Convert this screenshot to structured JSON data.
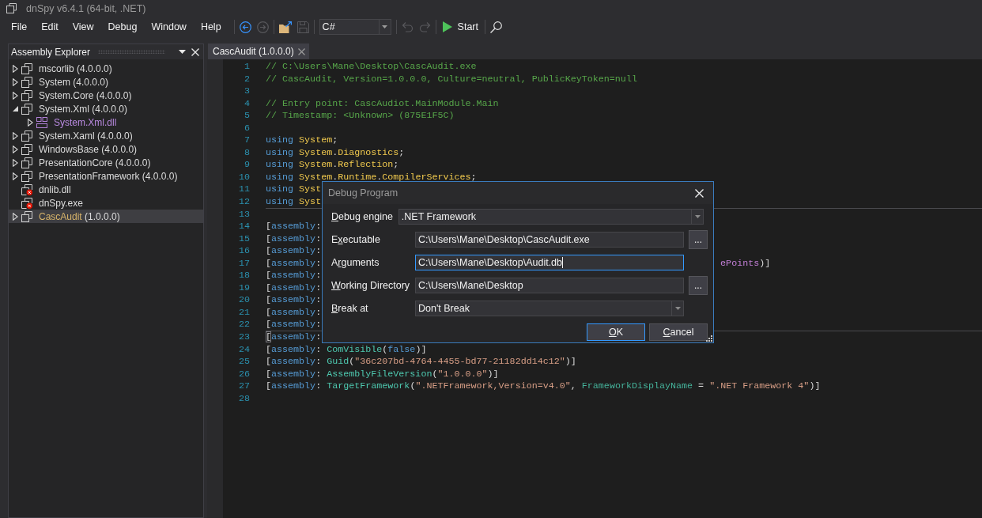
{
  "window": {
    "title": "dnSpy v6.4.1 (64-bit, .NET)"
  },
  "menu": [
    "File",
    "Edit",
    "View",
    "Debug",
    "Window",
    "Help"
  ],
  "toolbar": [
    {
      "items": [
        {
          "kind": "back",
          "disabled": false
        },
        {
          "kind": "forward",
          "disabled": true
        }
      ]
    },
    {
      "items": [
        {
          "kind": "open",
          "disabled": false
        },
        {
          "kind": "save",
          "disabled": true
        }
      ]
    },
    {
      "items": [
        {
          "kind": "language",
          "value": "C#",
          "disabled": false
        }
      ]
    },
    {
      "items": [
        {
          "kind": "undo",
          "disabled": true
        },
        {
          "kind": "redo",
          "disabled": true
        }
      ]
    },
    {
      "items": [
        {
          "kind": "start",
          "label": "Start",
          "disabled": false
        }
      ]
    },
    {
      "items": [
        {
          "kind": "search",
          "disabled": false
        }
      ]
    }
  ],
  "assembly_explorer": {
    "title": "Assembly Explorer",
    "items": [
      {
        "name": "mscorlib",
        "version": "(4.0.0.0)",
        "kind": "assembly",
        "expanded": false,
        "selected": false
      },
      {
        "name": "System",
        "version": "(4.0.0.0)",
        "kind": "assembly",
        "expanded": false,
        "selected": false
      },
      {
        "name": "System.Core",
        "version": "(4.0.0.0)",
        "kind": "assembly",
        "expanded": false,
        "selected": false
      },
      {
        "name": "System.Xml",
        "version": "(4.0.0.0)",
        "kind": "assembly",
        "expanded": true,
        "selected": false,
        "children": [
          {
            "name": "System.Xml.dll",
            "kind": "module",
            "expanded": false,
            "selected": false
          }
        ]
      },
      {
        "name": "System.Xaml",
        "version": "(4.0.0.0)",
        "kind": "assembly",
        "expanded": false,
        "selected": false
      },
      {
        "name": "WindowsBase",
        "version": "(4.0.0.0)",
        "kind": "assembly",
        "expanded": false,
        "selected": false
      },
      {
        "name": "PresentationCore",
        "version": "(4.0.0.0)",
        "kind": "assembly",
        "expanded": false,
        "selected": false
      },
      {
        "name": "PresentationFramework",
        "version": "(4.0.0.0)",
        "kind": "assembly",
        "expanded": false,
        "selected": false
      },
      {
        "name": "dnlib.dll",
        "kind": "missing",
        "selected": false
      },
      {
        "name": "dnSpy.exe",
        "kind": "missing",
        "selected": false
      },
      {
        "name": "CascAudit",
        "version": "(1.0.0.0)",
        "kind": "assembly",
        "expanded": false,
        "selected": true
      }
    ]
  },
  "editor": {
    "tabs": [
      {
        "label": "CascAudit (1.0.0.0)",
        "selected": true
      }
    ],
    "sections": [
      {
        "lines": [
          {
            "number": "1",
            "tokens": [
              {
                "kind": "comment",
                "text": "// C:\\Users\\Mane\\Desktop\\CascAudit.exe"
              }
            ]
          },
          {
            "number": "2",
            "tokens": [
              {
                "kind": "comment",
                "text": "// CascAudit, Version=1.0.0.0, Culture=neutral, PublicKeyToken=null"
              }
            ]
          },
          {
            "number": "3"
          },
          {
            "number": "4",
            "tokens": [
              {
                "kind": "comment",
                "text": "// Entry point: CascAudiot.MainModule.Main"
              }
            ]
          },
          {
            "number": "5",
            "tokens": [
              {
                "kind": "comment",
                "text": "// Timestamp: <Unknown> (875E1F5C)"
              }
            ]
          },
          {
            "number": "6"
          },
          {
            "number": "7",
            "tokens": [
              {
                "kind": "keyword",
                "text": "using "
              },
              {
                "kind": "namespace",
                "text": "System"
              },
              {
                "kind": "punct",
                "text": ";"
              }
            ]
          },
          {
            "number": "8",
            "tokens": [
              {
                "kind": "keyword",
                "text": "using "
              },
              {
                "kind": "namespace",
                "text": "System"
              },
              {
                "kind": "punct",
                "text": "."
              },
              {
                "kind": "namespace",
                "text": "Diagnostics"
              },
              {
                "kind": "punct",
                "text": ";"
              }
            ]
          },
          {
            "number": "9",
            "tokens": [
              {
                "kind": "keyword",
                "text": "using "
              },
              {
                "kind": "namespace",
                "text": "System"
              },
              {
                "kind": "punct",
                "text": "."
              },
              {
                "kind": "namespace",
                "text": "Reflection"
              },
              {
                "kind": "punct",
                "text": ";"
              }
            ]
          },
          {
            "number": "10",
            "tokens": [
              {
                "kind": "keyword",
                "text": "using "
              },
              {
                "kind": "namespace",
                "text": "System"
              },
              {
                "kind": "punct",
                "text": "."
              },
              {
                "kind": "namespace",
                "text": "Runtime"
              },
              {
                "kind": "punct",
                "text": "."
              },
              {
                "kind": "namespace",
                "text": "CompilerServices"
              },
              {
                "kind": "punct",
                "text": ";"
              }
            ]
          },
          {
            "number": "11",
            "tokens": [
              {
                "kind": "keyword",
                "text": "using "
              },
              {
                "kind": "namespace",
                "text": "Syst"
              }
            ]
          },
          {
            "number": "12",
            "tokens": [
              {
                "kind": "keyword",
                "text": "using "
              },
              {
                "kind": "namespace",
                "text": "Syst"
              }
            ]
          }
        ]
      },
      {
        "lines": [
          {
            "number": "13"
          },
          {
            "number": "14",
            "tokens": [
              {
                "kind": "punct",
                "text": "["
              },
              {
                "kind": "keyword",
                "text": "assembly"
              },
              {
                "kind": "punct",
                "text": ":"
              }
            ]
          },
          {
            "number": "15",
            "tokens": [
              {
                "kind": "punct",
                "text": "["
              },
              {
                "kind": "keyword",
                "text": "assembly"
              },
              {
                "kind": "punct",
                "text": ":"
              }
            ]
          },
          {
            "number": "16",
            "tokens": [
              {
                "kind": "punct",
                "text": "["
              },
              {
                "kind": "keyword",
                "text": "assembly"
              },
              {
                "kind": "punct",
                "text": ":"
              }
            ]
          },
          {
            "number": "17",
            "tokens": [
              {
                "kind": "punct",
                "text": "["
              },
              {
                "kind": "keyword",
                "text": "assembly"
              },
              {
                "kind": "punct",
                "text": ":"
              }
            ],
            "tail": [
              {
                "kind": "enum",
                "text": "ePoints"
              },
              {
                "kind": "punct",
                "text": ")]"
              }
            ]
          },
          {
            "number": "18",
            "tokens": [
              {
                "kind": "punct",
                "text": "["
              },
              {
                "kind": "keyword",
                "text": "assembly"
              },
              {
                "kind": "punct",
                "text": ":"
              }
            ]
          },
          {
            "number": "19",
            "tokens": [
              {
                "kind": "punct",
                "text": "["
              },
              {
                "kind": "keyword",
                "text": "assembly"
              },
              {
                "kind": "punct",
                "text": ":"
              }
            ]
          },
          {
            "number": "20",
            "tokens": [
              {
                "kind": "punct",
                "text": "["
              },
              {
                "kind": "keyword",
                "text": "assembly"
              },
              {
                "kind": "punct",
                "text": ":"
              }
            ]
          },
          {
            "number": "21",
            "tokens": [
              {
                "kind": "punct",
                "text": "["
              },
              {
                "kind": "keyword",
                "text": "assembly"
              },
              {
                "kind": "punct",
                "text": ":"
              }
            ]
          },
          {
            "number": "22",
            "tokens": [
              {
                "kind": "punct",
                "text": "["
              },
              {
                "kind": "keyword",
                "text": "assembly"
              },
              {
                "kind": "punct",
                "text": ":"
              }
            ]
          }
        ]
      },
      {
        "lines": [
          {
            "number": "23",
            "tokens": [
              {
                "kind": "brace",
                "text": "["
              },
              {
                "kind": "keyword",
                "text": "assembly"
              },
              {
                "kind": "punct",
                "text": ":"
              }
            ]
          },
          {
            "number": "24",
            "tokens": [
              {
                "kind": "punct",
                "text": "["
              },
              {
                "kind": "keyword",
                "text": "assembly"
              },
              {
                "kind": "punct",
                "text": ": "
              },
              {
                "kind": "type",
                "text": "ComVisible"
              },
              {
                "kind": "punct",
                "text": "("
              },
              {
                "kind": "keyword",
                "text": "false"
              },
              {
                "kind": "punct",
                "text": ")]"
              }
            ]
          },
          {
            "number": "25",
            "tokens": [
              {
                "kind": "punct",
                "text": "["
              },
              {
                "kind": "keyword",
                "text": "assembly"
              },
              {
                "kind": "punct",
                "text": ": "
              },
              {
                "kind": "type",
                "text": "Guid"
              },
              {
                "kind": "punct",
                "text": "("
              },
              {
                "kind": "string",
                "text": "\"36c207bd-4764-4455-bd77-21182dd14c12\""
              },
              {
                "kind": "punct",
                "text": ")]"
              }
            ]
          },
          {
            "number": "26",
            "tokens": [
              {
                "kind": "punct",
                "text": "["
              },
              {
                "kind": "keyword",
                "text": "assembly"
              },
              {
                "kind": "punct",
                "text": ": "
              },
              {
                "kind": "type",
                "text": "AssemblyFileVersion"
              },
              {
                "kind": "punct",
                "text": "("
              },
              {
                "kind": "string",
                "text": "\"1.0.0.0\""
              },
              {
                "kind": "punct",
                "text": ")]"
              }
            ]
          },
          {
            "number": "27",
            "tokens": [
              {
                "kind": "punct",
                "text": "["
              },
              {
                "kind": "keyword",
                "text": "assembly"
              },
              {
                "kind": "punct",
                "text": ": "
              },
              {
                "kind": "type",
                "text": "TargetFramework"
              },
              {
                "kind": "punct",
                "text": "("
              },
              {
                "kind": "string",
                "text": "\".NETFramework,Version=v4.0\""
              },
              {
                "kind": "punct",
                "text": ", "
              },
              {
                "kind": "property",
                "text": "FrameworkDisplayName"
              },
              {
                "kind": "punct",
                "text": " = "
              },
              {
                "kind": "string",
                "text": "\".NET Framework 4\""
              },
              {
                "kind": "punct",
                "text": ")]"
              }
            ]
          },
          {
            "number": "28"
          }
        ]
      }
    ]
  },
  "dialog": {
    "title": "Debug Program",
    "rows": [
      {
        "kind": "dropdown",
        "label": {
          "key": "D",
          "after": "ebug engine"
        },
        "value": ".NET Framework",
        "focused": false
      },
      {
        "kind": "path",
        "label": {
          "before": "E",
          "key": "x",
          "after": "ecutable"
        },
        "value": "C:\\Users\\Mane\\Desktop\\CascAudit.exe",
        "browse": "...",
        "focused": false
      },
      {
        "kind": "text",
        "label": {
          "before": "A",
          "key": "r",
          "after": "guments"
        },
        "value": "C:\\Users\\Mane\\Desktop\\Audit.db",
        "focused": true
      },
      {
        "kind": "path",
        "label": {
          "key": "W",
          "after": "orking Directory"
        },
        "value": "C:\\Users\\Mane\\Desktop",
        "browse": "...",
        "focused": false
      },
      {
        "kind": "combo",
        "label": {
          "key": "B",
          "after": "reak at"
        },
        "value": "Don't Break",
        "focused": false
      }
    ],
    "buttons": [
      {
        "label": {
          "key": "O",
          "after": "K"
        },
        "default": true
      },
      {
        "label": {
          "key": "C",
          "after": "ancel"
        },
        "default": false
      }
    ]
  }
}
